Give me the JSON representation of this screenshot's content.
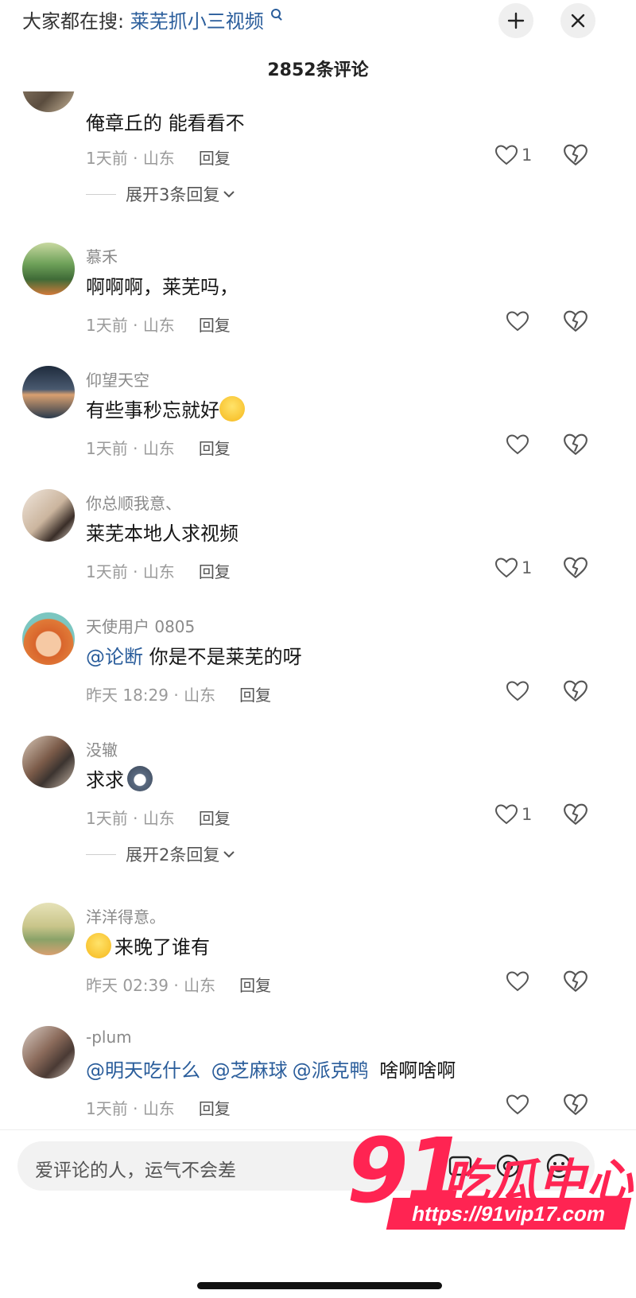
{
  "header": {
    "trend_label": "大家都在搜:",
    "trend_link": "莱芜抓小三视频",
    "comment_count": "2852条评论"
  },
  "comments": [
    {
      "username": "",
      "text": "俺章丘的 能看看不",
      "time": "1天前",
      "location": "山东",
      "reply": "回复",
      "likes": "1",
      "expand": "展开3条回复"
    },
    {
      "username": "慕禾",
      "text": "啊啊啊，莱芜吗，",
      "time": "1天前",
      "location": "山东",
      "reply": "回复",
      "likes": ""
    },
    {
      "username": "仰望天空",
      "text": "有些事秒忘就好",
      "time": "1天前",
      "location": "山东",
      "reply": "回复",
      "likes": ""
    },
    {
      "username": "你总顺我意、",
      "text": "莱芜本地人求视频",
      "time": "1天前",
      "location": "山东",
      "reply": "回复",
      "likes": "1"
    },
    {
      "username": "天使用户 0805",
      "mention": "@论断",
      "text": " 你是不是莱芜的呀",
      "time": "昨天 18:29",
      "location": "山东",
      "reply": "回复",
      "likes": ""
    },
    {
      "username": "没辙",
      "text": "求求",
      "time": "1天前",
      "location": "山东",
      "reply": "回复",
      "likes": "1",
      "expand": "展开2条回复"
    },
    {
      "username": "洋洋得意。",
      "text": "来晚了谁有",
      "time": "昨天 02:39",
      "location": "山东",
      "reply": "回复",
      "likes": ""
    },
    {
      "username": "-plum",
      "mentions": [
        "@明天吃什么",
        "@芝麻球",
        "@派克鸭"
      ],
      "text": "啥啊啥啊",
      "time": "1天前",
      "location": "山东",
      "reply": "回复",
      "likes": ""
    }
  ],
  "input": {
    "placeholder": "爱评论的人，运气不会差"
  },
  "watermark": {
    "number": "91",
    "name": "吃瓜中心",
    "url": "https://91vip17.com"
  }
}
